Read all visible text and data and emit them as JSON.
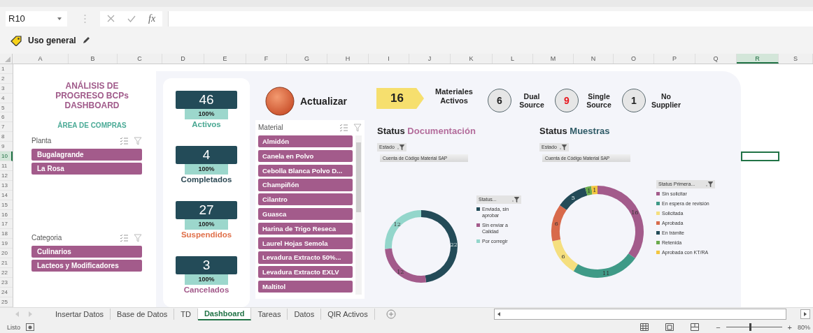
{
  "formula_bar": {
    "name_box": "R10",
    "function_label": "fx"
  },
  "sensitivity_label": "Uso general",
  "columns": [
    {
      "label": "A",
      "selected": false
    },
    {
      "label": "B",
      "selected": false
    },
    {
      "label": "C",
      "selected": false
    },
    {
      "label": "D",
      "selected": false
    },
    {
      "label": "E",
      "selected": false
    },
    {
      "label": "F",
      "selected": false
    },
    {
      "label": "G",
      "selected": false
    },
    {
      "label": "H",
      "selected": false
    },
    {
      "label": "I",
      "selected": false
    },
    {
      "label": "J",
      "selected": false
    },
    {
      "label": "K",
      "selected": false
    },
    {
      "label": "L",
      "selected": false
    },
    {
      "label": "M",
      "selected": false
    },
    {
      "label": "N",
      "selected": false
    },
    {
      "label": "O",
      "selected": false
    },
    {
      "label": "P",
      "selected": false
    },
    {
      "label": "Q",
      "selected": false
    },
    {
      "label": "R",
      "selected": true
    },
    {
      "label": "S",
      "selected": false
    }
  ],
  "rows": [
    {
      "label": "1",
      "selected": false
    },
    {
      "label": "2",
      "selected": false
    },
    {
      "label": "3",
      "selected": false
    },
    {
      "label": "4",
      "selected": false
    },
    {
      "label": "5",
      "selected": false
    },
    {
      "label": "6",
      "selected": false
    },
    {
      "label": "7",
      "selected": false
    },
    {
      "label": "8",
      "selected": false
    },
    {
      "label": "9",
      "selected": false
    },
    {
      "label": "10",
      "selected": true
    },
    {
      "label": "11",
      "selected": false
    },
    {
      "label": "12",
      "selected": false
    },
    {
      "label": "13",
      "selected": false
    },
    {
      "label": "14",
      "selected": false
    },
    {
      "label": "15",
      "selected": false
    },
    {
      "label": "16",
      "selected": false
    },
    {
      "label": "17",
      "selected": false
    },
    {
      "label": "18",
      "selected": false
    },
    {
      "label": "19",
      "selected": false
    },
    {
      "label": "20",
      "selected": false
    },
    {
      "label": "21",
      "selected": false
    },
    {
      "label": "22",
      "selected": false
    },
    {
      "label": "23",
      "selected": false
    },
    {
      "label": "24",
      "selected": false
    },
    {
      "label": "25",
      "selected": false
    }
  ],
  "dashboard": {
    "title": "ANÁLISIS DE PROGRESO BCPs DASHBOARD",
    "subtitle": "ÁREA DE COMPRAS",
    "planta_slicer": {
      "title": "Planta",
      "items": [
        {
          "label": "Bugalagrande",
          "selected": true
        },
        {
          "label": "La Rosa",
          "selected": true
        }
      ]
    },
    "categoria_slicer": {
      "title": "Categoria",
      "items": [
        {
          "label": "Culinarios",
          "selected": true
        },
        {
          "label": "Lacteos y Modificadores",
          "selected": true
        }
      ]
    },
    "kpis": [
      {
        "value": "46",
        "percent": "100%",
        "label": "Activos",
        "color": "#4aa893"
      },
      {
        "value": "4",
        "percent": "100%",
        "label": "Completados",
        "color": "#2e4a55"
      },
      {
        "value": "27",
        "percent": "100%",
        "label": "Suspendidos",
        "color": "#e0704a"
      },
      {
        "value": "3",
        "percent": "100%",
        "label": "Cancelados",
        "color": "#a35b8b"
      }
    ],
    "refresh_button": "Actualizar",
    "active_materials": {
      "value": "16",
      "label": "Materiales Activos"
    },
    "sources": [
      {
        "value": "6",
        "label": "Dual Source",
        "color": "#222222"
      },
      {
        "value": "9",
        "label": "Single Source",
        "color": "#e8141b"
      },
      {
        "value": "1",
        "label": "No Supplier",
        "color": "#222222"
      }
    ],
    "material_slicer": {
      "title": "Material",
      "items": [
        {
          "label": "Almidón",
          "selected": true
        },
        {
          "label": "Canela en Polvo",
          "selected": true
        },
        {
          "label": "Cebolla Blanca Polvo D...",
          "selected": true
        },
        {
          "label": "Champiñón",
          "selected": true
        },
        {
          "label": "Cilantro",
          "selected": true
        },
        {
          "label": "Guasca",
          "selected": true
        },
        {
          "label": "Harina de Trigo Reseca",
          "selected": true
        },
        {
          "label": "Laurel Hojas Semola",
          "selected": true
        },
        {
          "label": "Levadura Extracto 50%...",
          "selected": true
        },
        {
          "label": "Levadura Extracto EXLV",
          "selected": true
        },
        {
          "label": "Maltitol",
          "selected": true
        }
      ]
    },
    "charts": [
      {
        "heading": "Status",
        "heading_highlight": "Documentación",
        "filter": "Estado",
        "legend_filter": "Status...",
        "chart_data": {
          "type": "donut",
          "categories": [
            "Enviada, sin aprobar",
            "Sin enviar a Calidad",
            "Por corregir"
          ],
          "series": [
            {
              "name": "Cuenta de Código Material SAP",
              "values": [
                22,
                12,
                12
              ]
            }
          ],
          "data_labels": true
        }
      },
      {
        "heading": "Status",
        "heading_highlight": "Muestras",
        "filter": "Estado",
        "legend_filter": "Status Primera...",
        "chart_data": {
          "type": "donut",
          "categories": [
            "Sin solicitar",
            "En espera de revisión",
            "Solicitada",
            "Aprobada",
            "En trámite",
            "Retenida",
            "Aprobada con KT/RA"
          ],
          "series": [
            {
              "name": "Cuenta de Código Material SAP",
              "values": [
                16,
                11,
                6,
                6,
                5,
                1,
                1
              ]
            }
          ],
          "data_labels": true
        }
      }
    ]
  },
  "sheet_tabs": [
    {
      "label": "Insertar Datos",
      "selected": false
    },
    {
      "label": "Base de Datos",
      "selected": false
    },
    {
      "label": "TD",
      "selected": false
    },
    {
      "label": "Dashboard",
      "selected": true
    },
    {
      "label": "Tareas",
      "selected": false
    },
    {
      "label": "Datos",
      "selected": false
    },
    {
      "label": "QIR Activos",
      "selected": false
    }
  ],
  "status_bar": {
    "status": "Listo",
    "zoom_out": "−",
    "zoom_in": "+",
    "zoom": {
      "level": 0.42
    },
    "zoom_label": "80%"
  }
}
